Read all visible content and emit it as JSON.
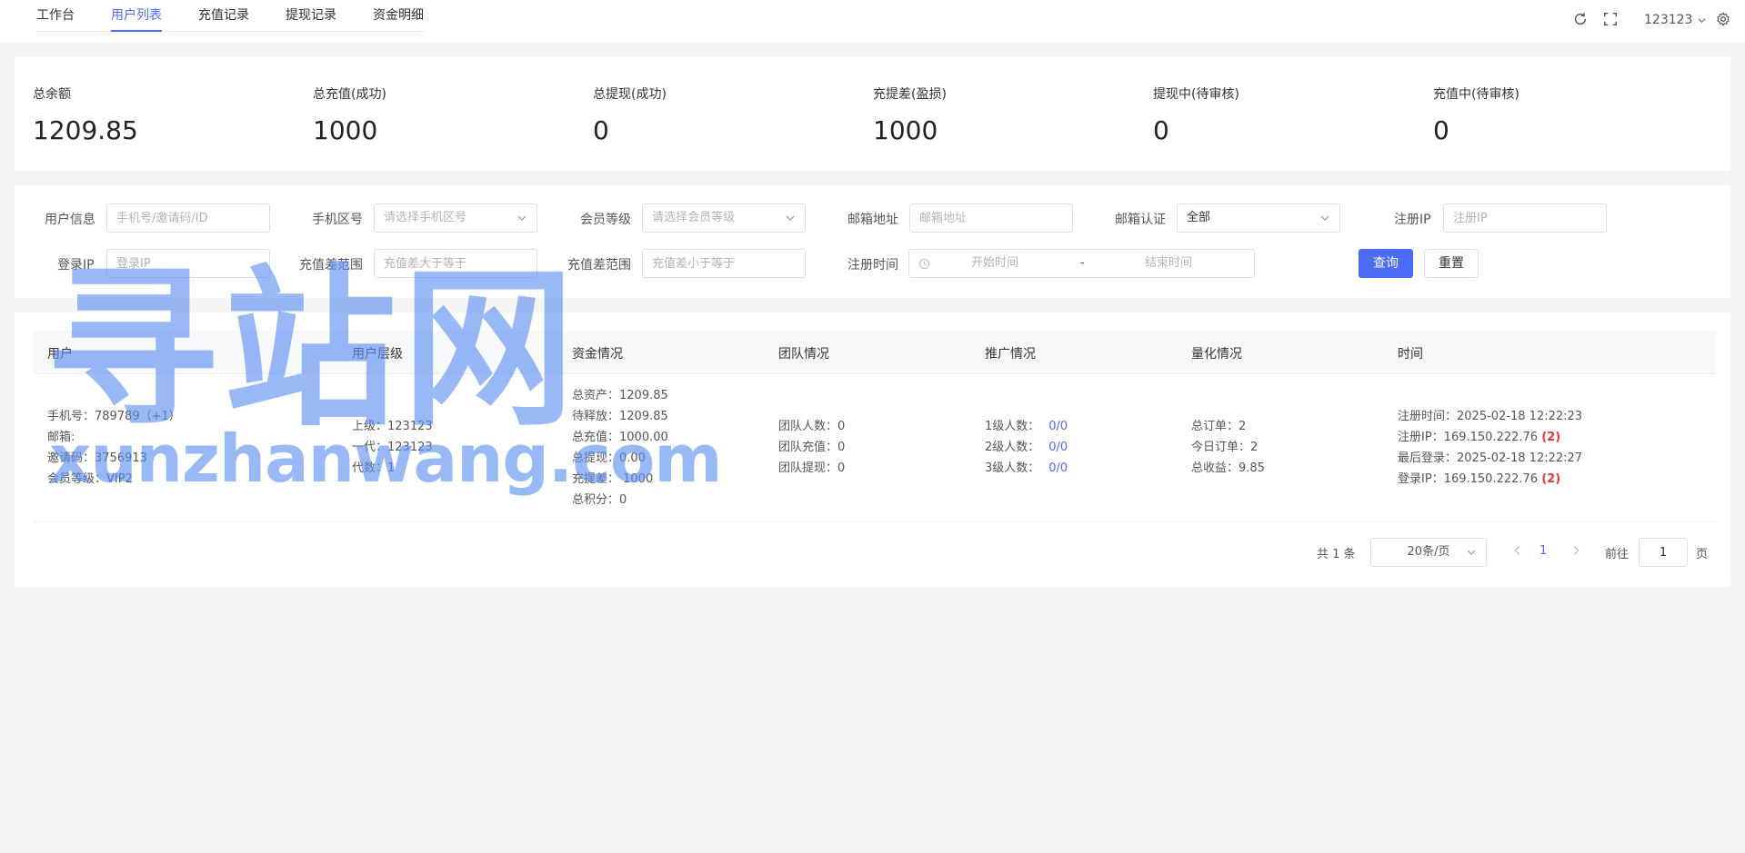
{
  "nav": {
    "tabs": [
      {
        "label": "工作台"
      },
      {
        "label": "用户列表"
      },
      {
        "label": "充值记录"
      },
      {
        "label": "提现记录"
      },
      {
        "label": "资金明细"
      }
    ],
    "active_tab": "用户列表",
    "username": "123123",
    "accent_color": "#4a6cf7"
  },
  "stats": [
    {
      "label": "总余额",
      "value": "1209.85"
    },
    {
      "label": "总充值(成功)",
      "value": "1000"
    },
    {
      "label": "总提现(成功)",
      "value": "0"
    },
    {
      "label": "充提差(盈损)",
      "value": "1000"
    },
    {
      "label": "提现中(待审核)",
      "value": "0"
    },
    {
      "label": "充值中(待审核)",
      "value": "0"
    }
  ],
  "filters": {
    "user_info": {
      "label": "用户信息",
      "placeholder": "手机号/邀请码/ID"
    },
    "phone_area": {
      "label": "手机区号",
      "placeholder": "请选择手机区号"
    },
    "member_level": {
      "label": "会员等级",
      "placeholder": "请选择会员等级"
    },
    "email": {
      "label": "邮箱地址",
      "placeholder": "邮箱地址"
    },
    "email_verify": {
      "label": "邮箱认证",
      "value": "全部"
    },
    "reg_ip": {
      "label": "注册IP",
      "placeholder": "注册IP"
    },
    "login_ip": {
      "label": "登录IP",
      "placeholder": "登录IP"
    },
    "diff_min": {
      "label": "充值差范围",
      "placeholder": "充值差大于等于"
    },
    "diff_max": {
      "label": "充值差范围",
      "placeholder": "充值差小于等于"
    },
    "reg_time": {
      "label": "注册时间",
      "start_placeholder": "开始时间",
      "separator": "-",
      "end_placeholder": "结束时间"
    },
    "query_label": "查询",
    "reset_label": "重置"
  },
  "table": {
    "headers": [
      "用户",
      "用户层级",
      "资金情况",
      "团队情况",
      "推广情况",
      "量化情况",
      "时间"
    ],
    "row": {
      "user": [
        "手机号：789789（+1）",
        "邮箱:",
        "邀请码：3756913",
        "会员等级：VIP2"
      ],
      "level": [
        "上级：123123",
        "一代：123123",
        "代数：1"
      ],
      "funds": [
        "总资产：1209.85",
        "待释放：1209.85",
        "总充值：1000.00",
        "总提现：0.00",
        "充提差： 1000",
        "总积分：0"
      ],
      "team": [
        "团队人数：0",
        "团队充值：0",
        "团队提现：0"
      ],
      "promo": [
        {
          "label": "1级人数：",
          "value": "0/0"
        },
        {
          "label": "2级人数：",
          "value": "0/0"
        },
        {
          "label": "3级人数：",
          "value": "0/0"
        }
      ],
      "quant": [
        "总订单：2",
        "今日订单：2",
        "总收益：9.85"
      ],
      "time": {
        "reg_time": "注册时间：2025-02-18 12:22:23",
        "reg_ip": "注册IP：169.150.222.76",
        "reg_ip_count": "(2)",
        "last_login": "最后登录：2025-02-18 12:22:27",
        "login_ip": "登录IP：169.150.222.76",
        "login_ip_count": "(2)"
      }
    }
  },
  "pagination": {
    "total": "共 1 条",
    "page_size": "20条/页",
    "current": "1",
    "goto_label": "前往",
    "goto_value": "1",
    "page_label": "页"
  },
  "watermark": {
    "text_cn": "寻站网",
    "text_en": "xunzhanwang.com"
  }
}
